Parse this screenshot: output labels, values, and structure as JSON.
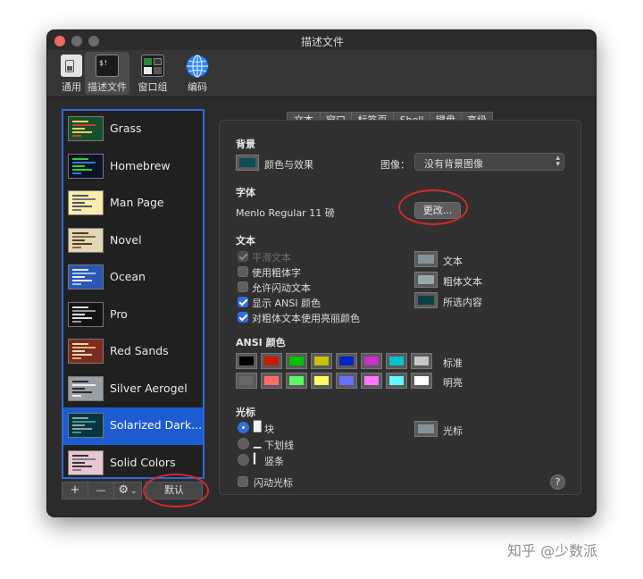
{
  "window": {
    "title": "描述文件",
    "traffic_lights": [
      "#ed6a5e",
      "#6a6a6a",
      "#6a6a6a"
    ]
  },
  "toolbar": {
    "items": [
      {
        "label": "通用",
        "icon": "general-switch-icon"
      },
      {
        "label": "描述文件",
        "icon": "terminal-profile-icon",
        "icon_text": "$!"
      },
      {
        "label": "窗口组",
        "icon": "window-groups-icon"
      },
      {
        "label": "编码",
        "icon": "globe-icon"
      }
    ],
    "selected": 1
  },
  "profiles": {
    "items": [
      {
        "name": "Grass",
        "bg": "#16502a",
        "fg": "#e6d25a",
        "accent": "#d33a2a"
      },
      {
        "name": "Homebrew",
        "bg": "#0b1426",
        "fg": "#29d13a",
        "accent": "#2c7bd6"
      },
      {
        "name": "Man Page",
        "bg": "#f6efad",
        "fg": "#555555",
        "accent": "#777777"
      },
      {
        "name": "Novel",
        "bg": "#e2d7b4",
        "fg": "#5a3c20",
        "accent": "#8a6b47"
      },
      {
        "name": "Ocean",
        "bg": "#2a57b4",
        "fg": "#e8e8e8",
        "accent": "#9fc0f5"
      },
      {
        "name": "Pro",
        "bg": "#141414",
        "fg": "#dddddd",
        "accent": "#9a9a9a"
      },
      {
        "name": "Red Sands",
        "bg": "#7c2b1f",
        "fg": "#eadbb5",
        "accent": "#e9b36a"
      },
      {
        "name": "Silver Aerogel",
        "bg": "#9a9fa6",
        "fg": "#2a2a2a",
        "accent": "#eeeeee"
      },
      {
        "name": "Solarized Dark...",
        "bg": "#073642",
        "fg": "#93a1a1",
        "accent": "#2aa198"
      },
      {
        "name": "Solid Colors",
        "bg": "#e9c7cf",
        "fg": "#333333",
        "accent": "#7a7a9a"
      }
    ],
    "selected": 8,
    "buttons": {
      "add": "+",
      "remove": "—",
      "gear": "⚙",
      "chevron": "⌄",
      "default": "默认"
    }
  },
  "tabs": {
    "items": [
      "文本",
      "窗口",
      "标签页",
      "Shell",
      "键盘",
      "高级"
    ],
    "selected": 0
  },
  "background": {
    "title": "背景",
    "color_effects_label": "颜色与效果",
    "color_swatch": "#0d4e56",
    "image_label": "图像：",
    "image_value": "没有背景图像"
  },
  "font": {
    "title": "字体",
    "current": "Menlo Regular 11 磅",
    "change_button": "更改..."
  },
  "text": {
    "title": "文本",
    "checkboxes": [
      {
        "label": "平滑文本",
        "checked": true,
        "disabled": true
      },
      {
        "label": "使用粗体字",
        "checked": false,
        "disabled": false
      },
      {
        "label": "允许闪动文本",
        "checked": false,
        "disabled": false
      },
      {
        "label": "显示 ANSI 颜色",
        "checked": true,
        "disabled": false
      },
      {
        "label": "对粗体文本使用亮丽颜色",
        "checked": true,
        "disabled": false
      }
    ],
    "color_wells": [
      {
        "label": "文本",
        "color": "#839496"
      },
      {
        "label": "粗体文本",
        "color": "#9aa7a8"
      },
      {
        "label": "所选内容",
        "color": "#0e3e48"
      }
    ]
  },
  "ansi": {
    "title": "ANSI 颜色",
    "normal_label": "标准",
    "bright_label": "明亮",
    "normal": [
      "#000000",
      "#c91b00",
      "#00c200",
      "#c7c400",
      "#0225c7",
      "#c930c7",
      "#00c5c7",
      "#c7c7c7"
    ],
    "bright": [
      "#676767",
      "#ff6d67",
      "#5ff967",
      "#fefb67",
      "#6871ff",
      "#ff76ff",
      "#5ffdff",
      "#feffff"
    ]
  },
  "cursor": {
    "title": "光标",
    "options": [
      {
        "label": "块",
        "glyph": "█",
        "selected": true
      },
      {
        "label": "下划线",
        "glyph": "▁",
        "selected": false
      },
      {
        "label": "竖条",
        "glyph": "▎",
        "selected": false
      }
    ],
    "blink_label": "闪动光标",
    "cursor_well_label": "光标",
    "cursor_color": "#839496",
    "help": "?"
  },
  "watermark": "知乎 @少数派",
  "annotation_color": "#d62a2a"
}
